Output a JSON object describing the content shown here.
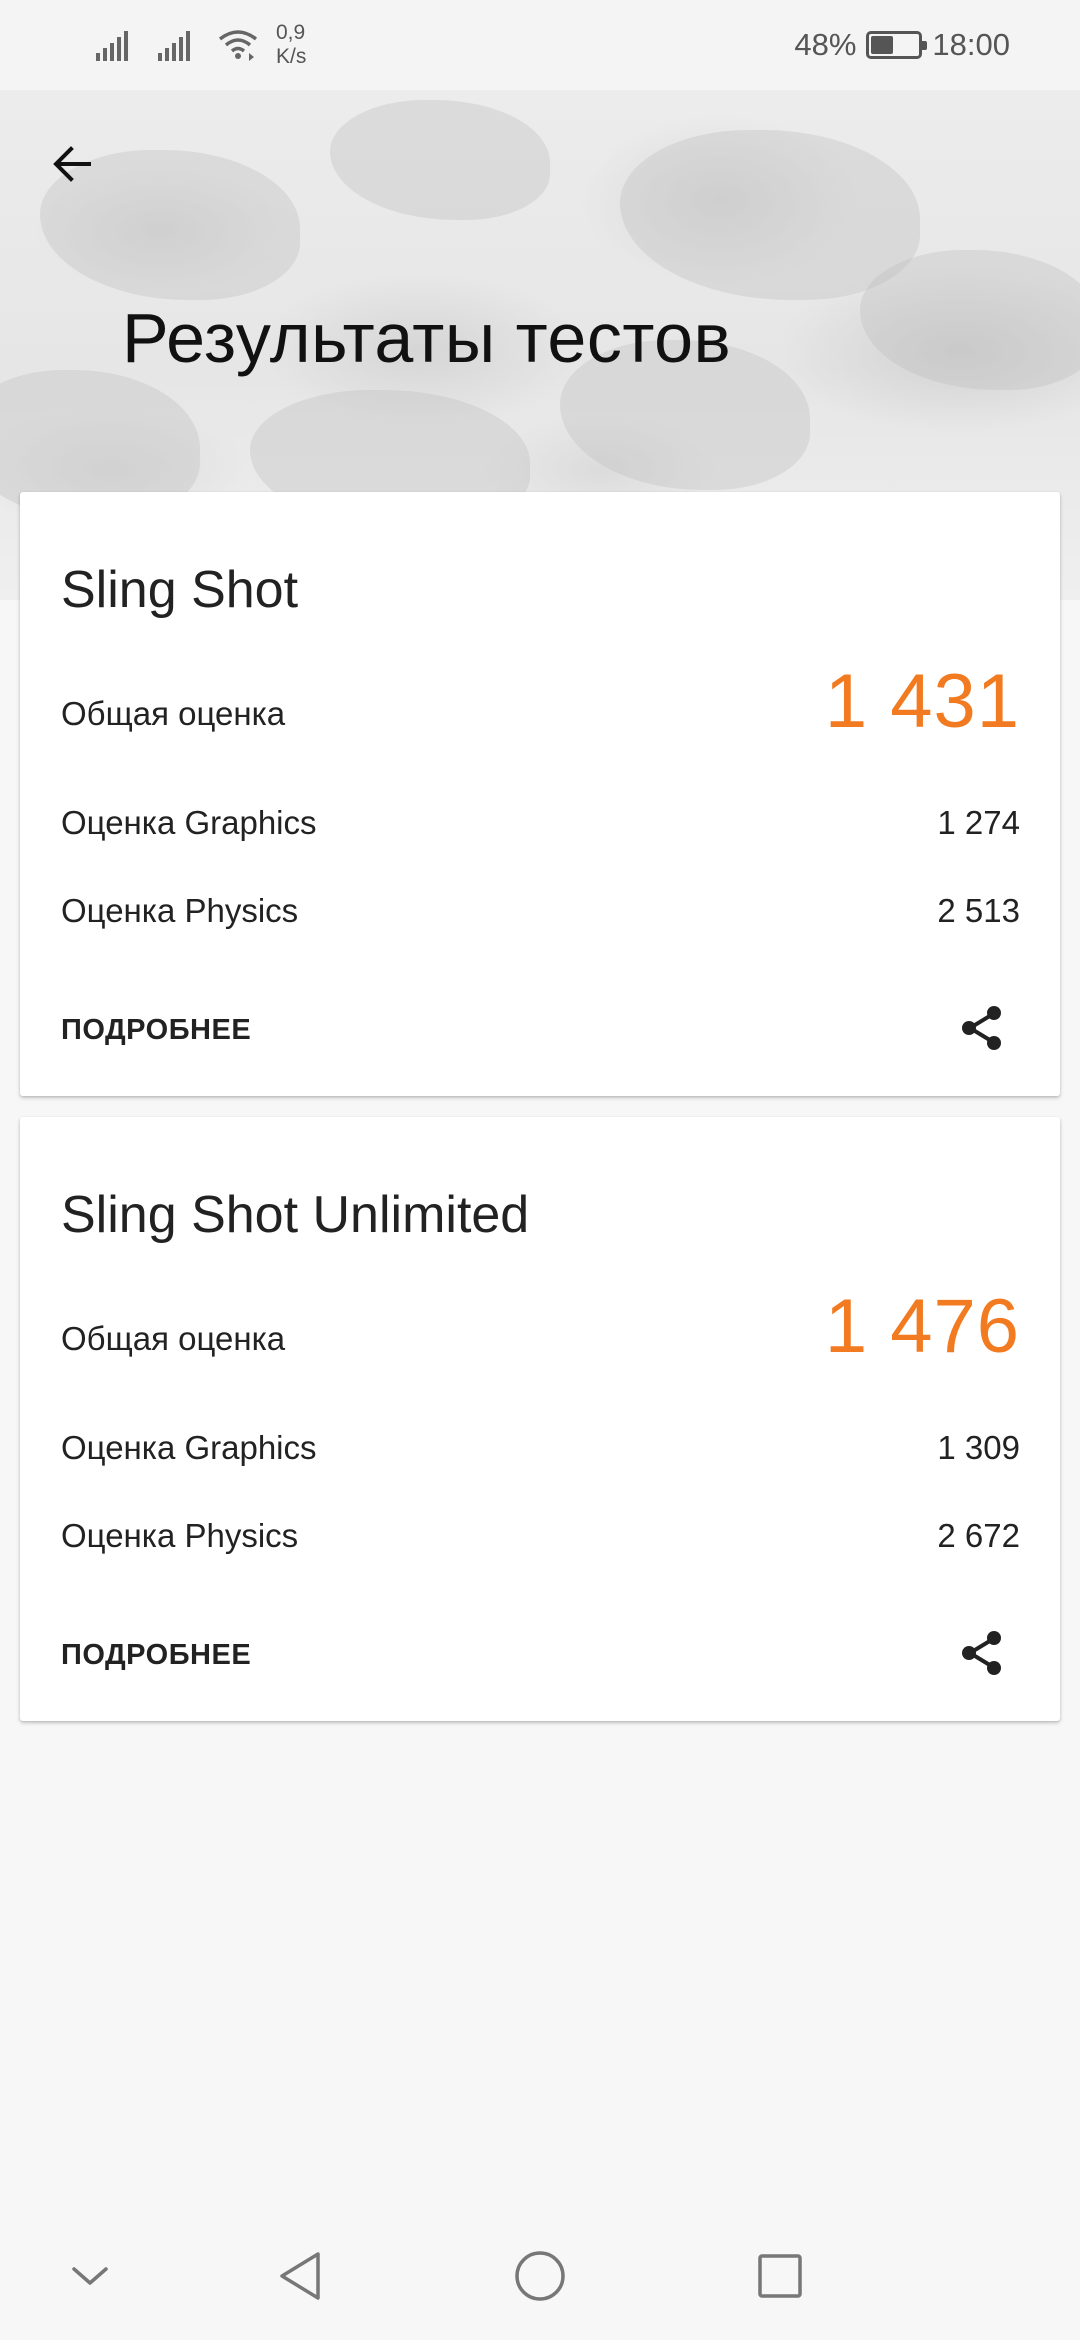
{
  "status_bar": {
    "net_speed_value": "0,9",
    "net_speed_unit": "K/s",
    "battery_percent": "48%",
    "battery_level": 0.48,
    "time": "18:00"
  },
  "header": {
    "title": "Результаты тестов"
  },
  "results": [
    {
      "name": "Sling Shot",
      "overall_label": "Общая оценка",
      "overall_score": "1 431",
      "graphics_label": "Оценка Graphics",
      "graphics_score": "1 274",
      "physics_label": "Оценка Physics",
      "physics_score": "2 513",
      "details_label": "ПОДРОБНЕЕ"
    },
    {
      "name": "Sling Shot Unlimited",
      "overall_label": "Общая оценка",
      "overall_score": "1 476",
      "graphics_label": "Оценка Graphics",
      "graphics_score": "1 309",
      "physics_label": "Оценка Physics",
      "physics_score": "2 672",
      "details_label": "ПОДРОБНЕЕ"
    }
  ],
  "icons": {
    "back": "arrow-left-icon",
    "share": "share-icon",
    "nav": [
      "chevron-down-icon",
      "triangle-back-icon",
      "circle-home-icon",
      "square-recent-icon"
    ]
  },
  "colors": {
    "accent": "#f27b21",
    "text": "#222222",
    "background": "#f7f7f7"
  }
}
